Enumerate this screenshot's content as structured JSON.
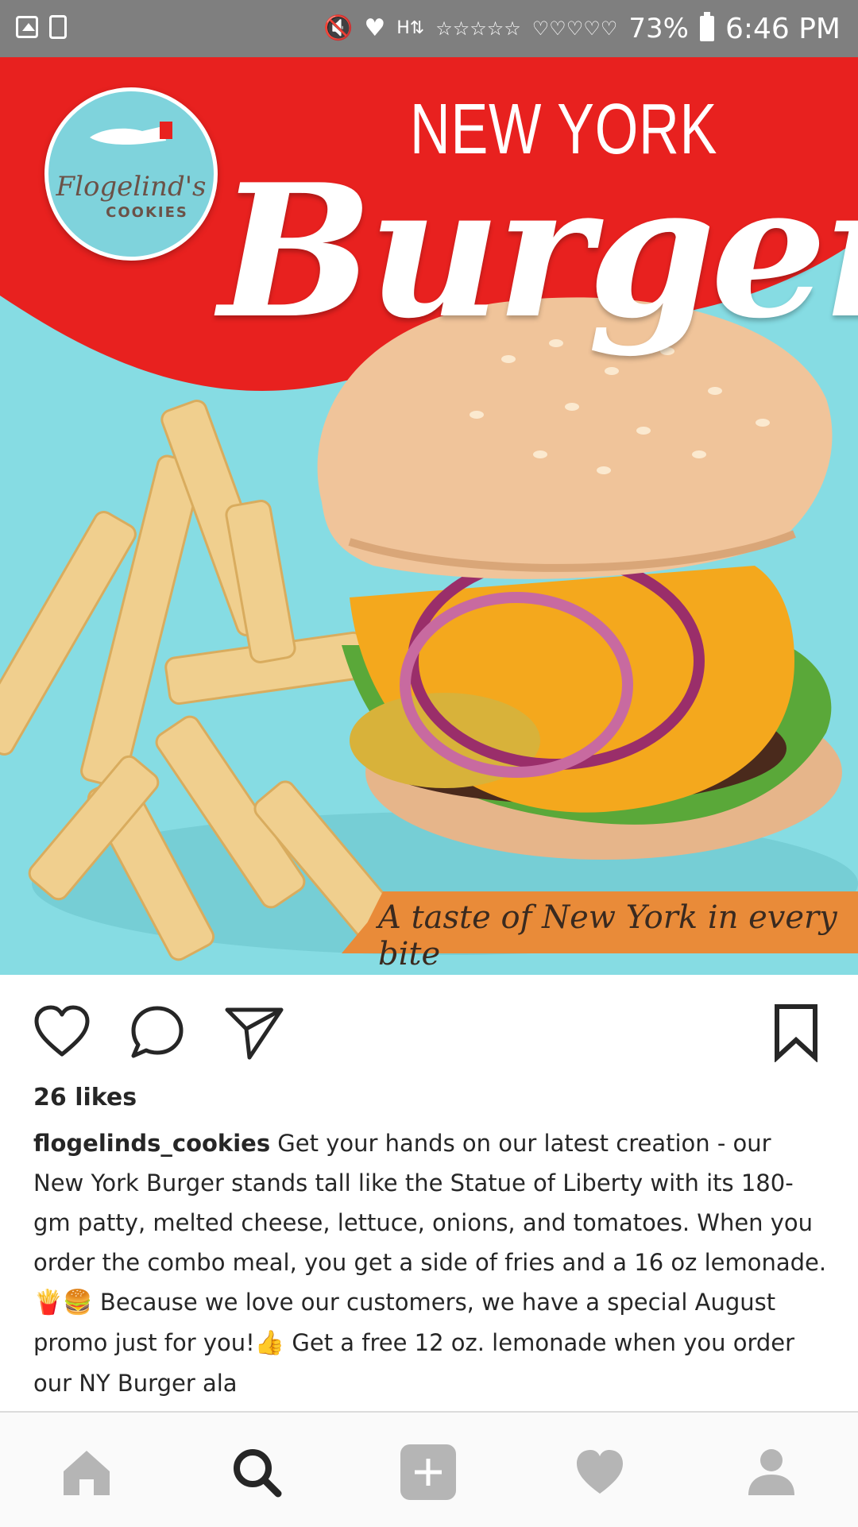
{
  "status_bar": {
    "battery": "73%",
    "time": "6:46 PM",
    "icons": [
      "gallery-icon",
      "clipboard-icon",
      "mute-icon",
      "notification-heart-icon",
      "h-signal-icon",
      "stars-icon",
      "hearts-icon",
      "battery-icon"
    ]
  },
  "post": {
    "image": {
      "logo_name": "Flogelind's",
      "logo_sub": "COOKIES",
      "headline_top": "NEW YORK",
      "headline_main": "Burger",
      "tagline": "A taste of New York in every bite",
      "colors": {
        "red": "#e8211f",
        "teal": "#86dce3",
        "orange": "#e98b39"
      }
    },
    "actions": {
      "like": "heart-outline-icon",
      "comment": "comment-bubble-icon",
      "share": "paper-plane-icon",
      "save": "bookmark-icon"
    },
    "likes": "26 likes",
    "caption": {
      "username": "flogelinds_cookies",
      "text_part1": " Get your hands on our latest creation - our New York Burger stands tall like the Statue of Liberty with its 180-gm patty,  melted cheese, lettuce, onions, and tomatoes. When you order the combo meal, you get a side of fries and a 16 oz lemonade.",
      "emoji1": "🍟🍔",
      "text_part2": " Because we love our customers, we have a special August promo just for you!",
      "emoji2": "👍",
      "text_part3": " Get a free 12 oz. lemonade when you order our NY Burger ala"
    }
  },
  "bottom_nav": {
    "items": [
      "home-icon",
      "search-icon",
      "add-post-icon",
      "activity-heart-icon",
      "profile-icon"
    ],
    "active": "search-icon"
  }
}
